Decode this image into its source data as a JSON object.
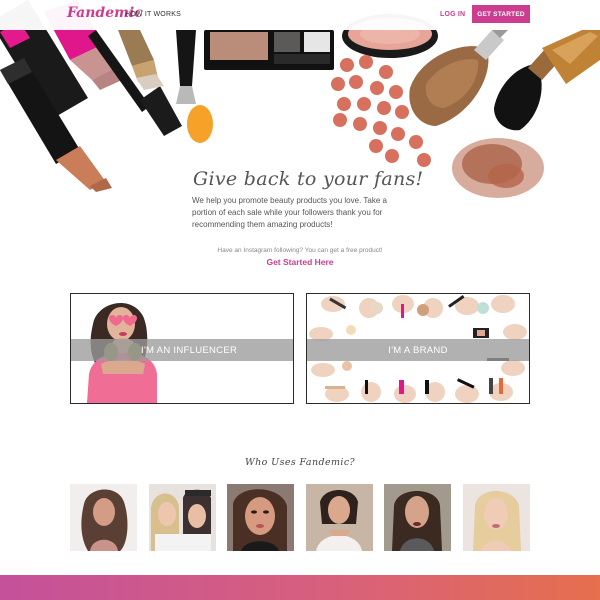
{
  "header": {
    "logo": "Fandemic",
    "nav_how": "HOW IT WORKS",
    "nav_login": "LOG IN",
    "cta_label": "GET STARTED"
  },
  "hero": {
    "title": "Give back to your fans!",
    "body": "We help you promote beauty products you love. Take a portion of each sale while your followers thank you for recommending them amazing products!",
    "note": "Have an Instagram following? You can get a free product!",
    "link_label": "Get Started Here",
    "images": [
      "lipstick",
      "mascara",
      "brush",
      "eyeshadow-palette",
      "compact",
      "beads",
      "powder-brush",
      "blush-brush",
      "powder-spill"
    ]
  },
  "cards": [
    {
      "label": "I'M AN INFLUENCER",
      "image": "woman-with-heart-sunglasses"
    },
    {
      "label": "I'M A BRAND",
      "image": "hands-holding-makeup"
    }
  ],
  "who": {
    "title": "Who Uses Fandemic?",
    "photos": [
      "influencer-1",
      "influencer-2",
      "influencer-3",
      "influencer-4",
      "influencer-5",
      "influencer-6"
    ]
  },
  "colors": {
    "brand": "#cc3d8f",
    "footer_gradient_start": "#c4519a",
    "footer_gradient_end": "#e66f4d"
  }
}
